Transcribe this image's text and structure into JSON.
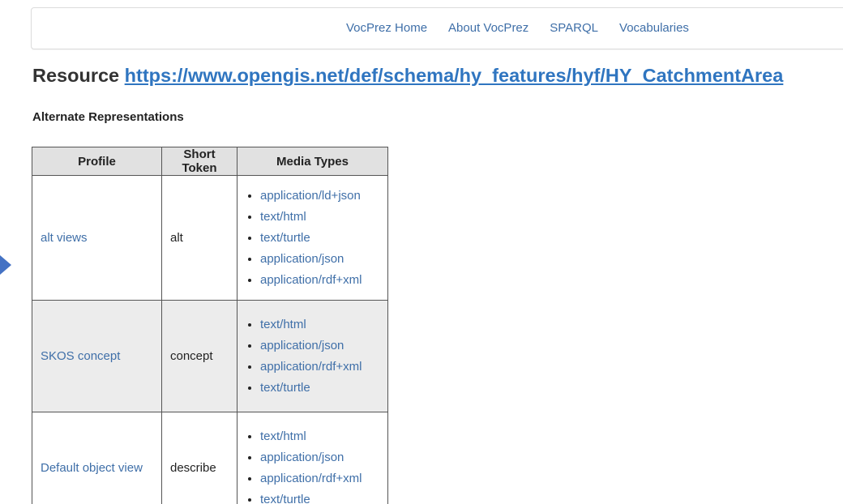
{
  "nav": {
    "links": [
      "VocPrez Home",
      "About VocPrez",
      "SPARQL",
      "Vocabularies"
    ]
  },
  "resource": {
    "label": "Resource",
    "uri": "https://www.opengis.net/def/schema/hy_features/hyf/HY_CatchmentArea"
  },
  "alternates": {
    "heading": "Alternate Representations",
    "columns": [
      "Profile",
      "Short Token",
      "Media Types"
    ],
    "rows": [
      {
        "profile": "alt views",
        "token": "alt",
        "media": [
          "application/ld+json",
          "text/html",
          "text/turtle",
          "application/json",
          "application/rdf+xml"
        ]
      },
      {
        "profile": "SKOS concept",
        "token": "concept",
        "media": [
          "text/html",
          "application/json",
          "application/rdf+xml",
          "text/turtle"
        ]
      },
      {
        "profile": "Default object view",
        "token": "describe",
        "media": [
          "text/html",
          "application/json",
          "application/rdf+xml",
          "text/turtle"
        ]
      }
    ]
  },
  "colors": {
    "link": "#3f6fa8",
    "heading_link": "#2f75c0",
    "header_bg": "#e1e1e1",
    "alt_row_bg": "#ececec",
    "arrow": "#4472c4"
  }
}
